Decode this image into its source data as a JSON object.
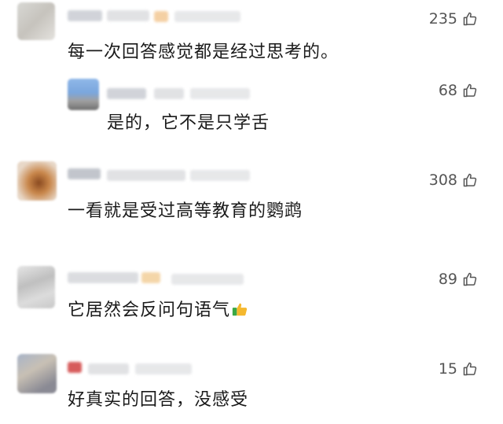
{
  "comments": [
    {
      "text": "每一次回答感觉都是经过思考的。",
      "likes": "235"
    },
    {
      "text": "是的，它不是只学舌",
      "likes": "68"
    },
    {
      "text": "一看就是受过高等教育的鹦鹉",
      "likes": "308"
    },
    {
      "text": "它居然会反问句语气",
      "likes": "89"
    },
    {
      "text": "好真实的回答，没感受",
      "likes": "15"
    }
  ],
  "icons": {
    "like": "thumbs-up-outline-icon",
    "emoji": "thumbs-up-emoji-icon"
  },
  "colors": {
    "like_stroke": "#555555",
    "emoji_yellow": "#f5b82e",
    "emoji_sleeve": "#3aa845"
  }
}
